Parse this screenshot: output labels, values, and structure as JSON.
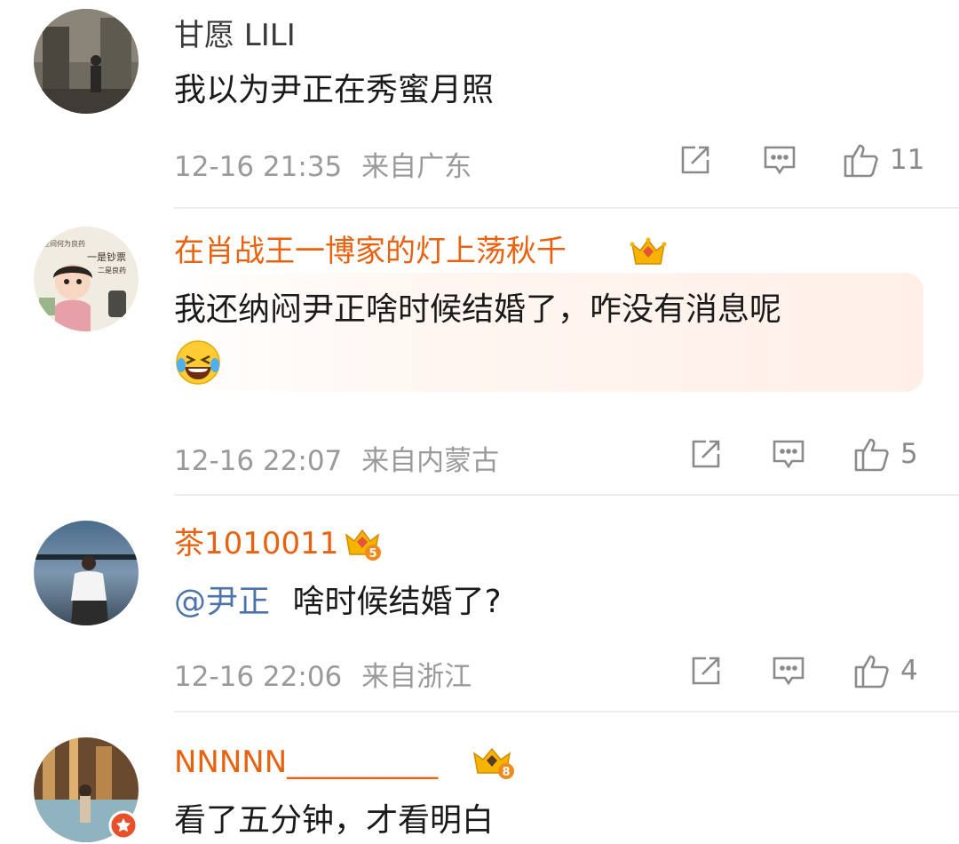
{
  "comments": [
    {
      "username": "甘愿 LILI",
      "text": "我以为尹正在秀蜜月照",
      "time": "12-16 21:35",
      "location": "来自广东",
      "likes": "11"
    },
    {
      "username": "在肖战王一博家的灯上荡秋千",
      "text": "我还纳闷尹正啥时候结婚了，咋没有消息呢",
      "emoji": "laughing-crying-icon",
      "time": "12-16 22:07",
      "location": "来自内蒙古",
      "likes": "5",
      "avatar_text": {
        "line1": "一是钞票",
        "line2": "二是良药",
        "top": "世间何为良药"
      }
    },
    {
      "username": "茶1010011",
      "mention": "@尹正",
      "text": "啥时候结婚了?",
      "time": "12-16 22:06",
      "location": "来自浙江",
      "likes": "4",
      "badge_level": "5"
    },
    {
      "username": "NNNNN__________",
      "text": "看了五分钟，才看明白",
      "badge_level": "8"
    }
  ],
  "colors": {
    "vip_name": "#e8620f",
    "mention": "#4d74a8",
    "meta": "#9a9a9a"
  }
}
